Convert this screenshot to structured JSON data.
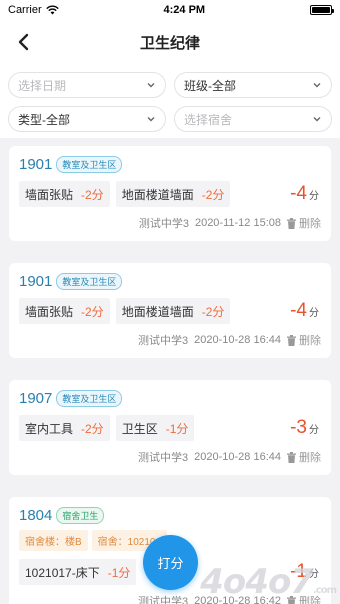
{
  "status_bar": {
    "carrier": "Carrier",
    "time": "4:24 PM"
  },
  "nav": {
    "title": "卫生纪律"
  },
  "filters": {
    "date_placeholder": "选择日期",
    "class_value": "班级-全部",
    "type_value": "类型-全部",
    "dorm_placeholder": "选择宿舍"
  },
  "records": [
    {
      "room": "1901",
      "tag": "教室及卫生区",
      "items": [
        {
          "label": "墙面张贴",
          "points": "-2分"
        },
        {
          "label": "地面楼道墙面",
          "points": "-2分"
        }
      ],
      "total": "-4",
      "unit": "分",
      "school": "测试中学3",
      "datetime": "2020-11-12 15:08",
      "delete_label": "删除"
    },
    {
      "room": "1901",
      "tag": "教室及卫生区",
      "items": [
        {
          "label": "墙面张贴",
          "points": "-2分"
        },
        {
          "label": "地面楼道墙面",
          "points": "-2分"
        }
      ],
      "total": "-4",
      "unit": "分",
      "school": "测试中学3",
      "datetime": "2020-10-28 16:44",
      "delete_label": "删除"
    },
    {
      "room": "1907",
      "tag": "教室及卫生区",
      "items": [
        {
          "label": "室内工具",
          "points": "-2分"
        },
        {
          "label": "卫生区",
          "points": "-1分"
        }
      ],
      "total": "-3",
      "unit": "分",
      "school": "测试中学3",
      "datetime": "2020-10-28 16:44",
      "delete_label": "删除"
    },
    {
      "room": "1804",
      "tag": "宿舍卫生",
      "info": [
        "宿舍楼：楼B",
        "宿舍：102101"
      ],
      "items": [
        {
          "label": "1021017-床下",
          "points": "-1分"
        }
      ],
      "total": "-1",
      "unit": "分",
      "school": "测试中学3",
      "datetime": "2020-10-28 16:42",
      "delete_label": "删除"
    }
  ],
  "fab": {
    "label": "打分"
  },
  "watermark": {
    "text": "4o4o7",
    "suffix": ".com"
  },
  "colors": {
    "accent": "#2196e8",
    "room": "#2a7fae",
    "penalty": "#e8532c"
  }
}
